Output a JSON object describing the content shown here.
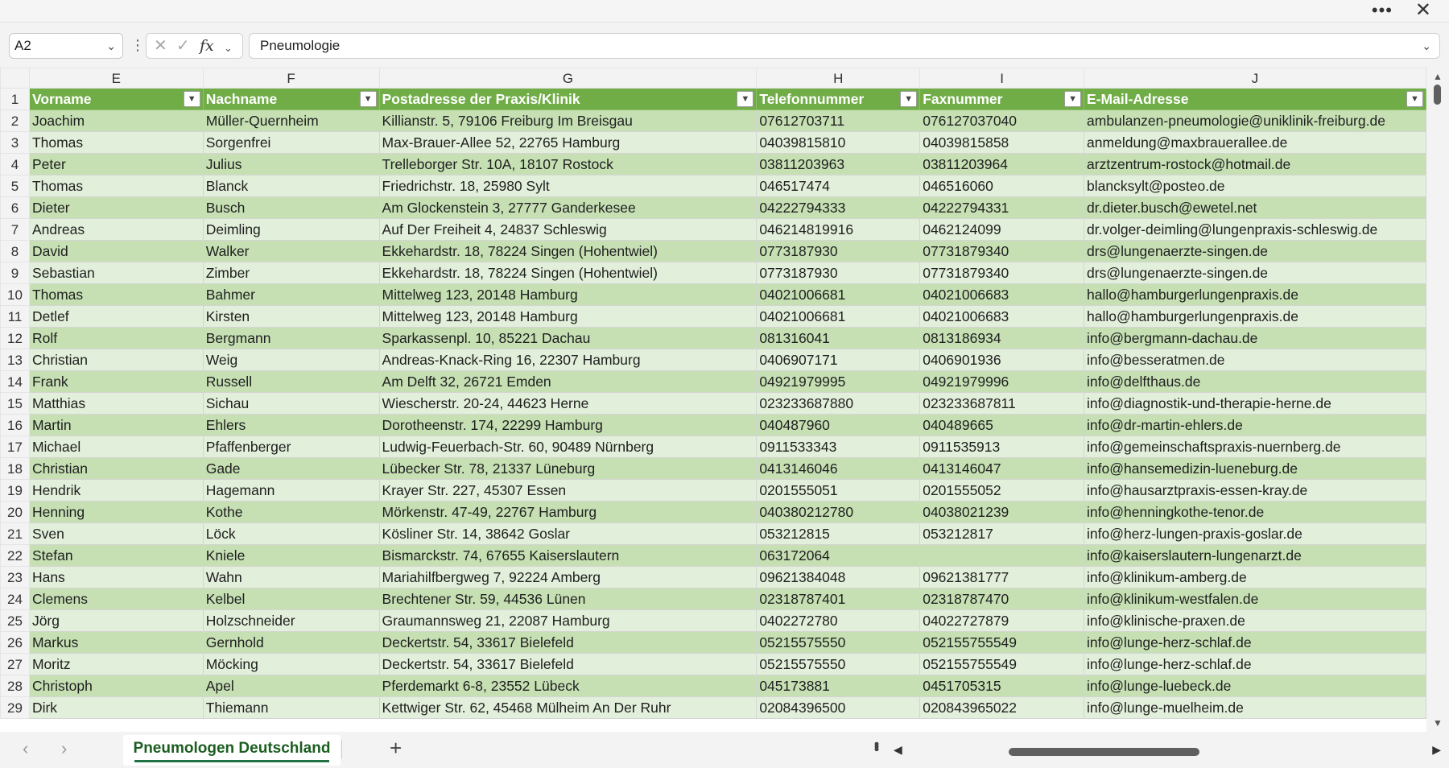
{
  "window": {
    "more_icon": "ellipsis-icon",
    "close_icon": "close-icon"
  },
  "formula_bar": {
    "name_box": "A2",
    "cancel_icon": "cancel-x-icon",
    "enter_icon": "checkmark-icon",
    "fx_label": "fx",
    "value": "Pneumologie"
  },
  "columns": [
    "E",
    "F",
    "G",
    "H",
    "I",
    "J"
  ],
  "header_row": {
    "row_number": "1",
    "cells": [
      "Vorname",
      "Nachname",
      "Postadresse der Praxis/Klinik",
      "Telefonnummer",
      "Faxnummer",
      "E-Mail-Adresse"
    ]
  },
  "rows": [
    {
      "n": "2",
      "cells": [
        "Joachim",
        "Müller-Quernheim",
        "Killianstr. 5, 79106 Freiburg Im Breisgau",
        "07612703711",
        "076127037040",
        "ambulanzen-pneumologie@uniklinik-freiburg.de"
      ]
    },
    {
      "n": "3",
      "cells": [
        "Thomas",
        "Sorgenfrei",
        "Max-Brauer-Allee 52, 22765 Hamburg",
        "04039815810",
        "04039815858",
        "anmeldung@maxbrauerallee.de"
      ]
    },
    {
      "n": "4",
      "cells": [
        "Peter",
        "Julius",
        "Trelleborger Str. 10A, 18107 Rostock",
        "03811203963",
        "03811203964",
        "arztzentrum-rostock@hotmail.de"
      ]
    },
    {
      "n": "5",
      "cells": [
        "Thomas",
        "Blanck",
        "Friedrichstr. 18, 25980 Sylt",
        "046517474",
        "046516060",
        "blancksylt@posteo.de"
      ]
    },
    {
      "n": "6",
      "cells": [
        "Dieter",
        "Busch",
        "Am Glockenstein 3, 27777 Ganderkesee",
        "04222794333",
        "04222794331",
        "dr.dieter.busch@ewetel.net"
      ]
    },
    {
      "n": "7",
      "cells": [
        "Andreas",
        "Deimling",
        "Auf Der Freiheit 4, 24837 Schleswig",
        "046214819916",
        "0462124099",
        "dr.volger-deimling@lungenpraxis-schleswig.de"
      ]
    },
    {
      "n": "8",
      "cells": [
        "David",
        "Walker",
        "Ekkehardstr. 18, 78224 Singen (Hohentwiel)",
        "0773187930",
        "07731879340",
        "drs@lungenaerzte-singen.de"
      ]
    },
    {
      "n": "9",
      "cells": [
        "Sebastian",
        "Zimber",
        "Ekkehardstr. 18, 78224 Singen (Hohentwiel)",
        "0773187930",
        "07731879340",
        "drs@lungenaerzte-singen.de"
      ]
    },
    {
      "n": "10",
      "cells": [
        "Thomas",
        "Bahmer",
        "Mittelweg 123, 20148 Hamburg",
        "04021006681",
        "04021006683",
        "hallo@hamburgerlungenpraxis.de"
      ]
    },
    {
      "n": "11",
      "cells": [
        "Detlef",
        "Kirsten",
        "Mittelweg 123, 20148 Hamburg",
        "04021006681",
        "04021006683",
        "hallo@hamburgerlungenpraxis.de"
      ]
    },
    {
      "n": "12",
      "cells": [
        "Rolf",
        "Bergmann",
        "Sparkassenpl. 10, 85221 Dachau",
        "081316041",
        "0813186934",
        "info@bergmann-dachau.de"
      ]
    },
    {
      "n": "13",
      "cells": [
        "Christian",
        "Weig",
        "Andreas-Knack-Ring 16, 22307 Hamburg",
        "0406907171",
        "0406901936",
        "info@besseratmen.de"
      ]
    },
    {
      "n": "14",
      "cells": [
        "Frank",
        "Russell",
        "Am Delft 32, 26721 Emden",
        "04921979995",
        "04921979996",
        "info@delfthaus.de"
      ]
    },
    {
      "n": "15",
      "cells": [
        "Matthias",
        "Sichau",
        "Wiescherstr. 20-24, 44623 Herne",
        "023233687880",
        "023233687811",
        "info@diagnostik-und-therapie-herne.de"
      ]
    },
    {
      "n": "16",
      "cells": [
        "Martin",
        "Ehlers",
        "Dorotheenstr. 174, 22299 Hamburg",
        "040487960",
        "040489665",
        "info@dr-martin-ehlers.de"
      ]
    },
    {
      "n": "17",
      "cells": [
        "Michael",
        "Pfaffenberger",
        "Ludwig-Feuerbach-Str. 60, 90489 Nürnberg",
        "0911533343",
        "0911535913",
        "info@gemeinschaftspraxis-nuernberg.de"
      ]
    },
    {
      "n": "18",
      "cells": [
        "Christian",
        "Gade",
        "Lübecker Str. 78, 21337 Lüneburg",
        "0413146046",
        "0413146047",
        "info@hansemedizin-lueneburg.de"
      ]
    },
    {
      "n": "19",
      "cells": [
        "Hendrik",
        "Hagemann",
        "Krayer Str. 227, 45307 Essen",
        "0201555051",
        "0201555052",
        "info@hausarztpraxis-essen-kray.de"
      ]
    },
    {
      "n": "20",
      "cells": [
        "Henning",
        "Kothe",
        "Mörkenstr. 47-49, 22767 Hamburg",
        "040380212780",
        "04038021239",
        "info@henningkothe-tenor.de"
      ]
    },
    {
      "n": "21",
      "cells": [
        "Sven",
        "Löck",
        "Kösliner Str. 14, 38642 Goslar",
        "053212815",
        "053212817",
        "info@herz-lungen-praxis-goslar.de"
      ]
    },
    {
      "n": "22",
      "cells": [
        "Stefan",
        "Kniele",
        "Bismarckstr. 74, 67655 Kaiserslautern",
        "063172064",
        "",
        "info@kaiserslautern-lungenarzt.de"
      ]
    },
    {
      "n": "23",
      "cells": [
        "Hans",
        "Wahn",
        "Mariahilfbergweg 7, 92224 Amberg",
        "09621384048",
        "09621381777",
        "info@klinikum-amberg.de"
      ]
    },
    {
      "n": "24",
      "cells": [
        "Clemens",
        "Kelbel",
        "Brechtener Str. 59, 44536 Lünen",
        "02318787401",
        "02318787470",
        "info@klinikum-westfalen.de"
      ]
    },
    {
      "n": "25",
      "cells": [
        "Jörg",
        "Holzschneider",
        "Graumannsweg 21, 22087 Hamburg",
        "0402272780",
        "04022727879",
        "info@klinische-praxen.de"
      ]
    },
    {
      "n": "26",
      "cells": [
        "Markus",
        "Gernhold",
        "Deckertstr. 54, 33617 Bielefeld",
        "05215575550",
        "052155755549",
        "info@lunge-herz-schlaf.de"
      ]
    },
    {
      "n": "27",
      "cells": [
        "Moritz",
        "Möcking",
        "Deckertstr. 54, 33617 Bielefeld",
        "05215575550",
        "052155755549",
        "info@lunge-herz-schlaf.de"
      ]
    },
    {
      "n": "28",
      "cells": [
        "Christoph",
        "Apel",
        "Pferdemarkt 6-8, 23552 Lübeck",
        "045173881",
        "0451705315",
        "info@lunge-luebeck.de"
      ]
    },
    {
      "n": "29",
      "cells": [
        "Dirk",
        "Thiemann",
        "Kettwiger Str. 62, 45468 Mülheim An Der Ruhr",
        "02084396500",
        "020843965022",
        "info@lunge-muelheim.de"
      ]
    }
  ],
  "sheet_tabs": [
    {
      "label": "Pneumologen Deutschland",
      "active": true
    }
  ],
  "colors": {
    "header_green": "#70ad47",
    "band_dark": "#c6e0b4",
    "band_light": "#e2efda",
    "active_tab": "#217346"
  }
}
